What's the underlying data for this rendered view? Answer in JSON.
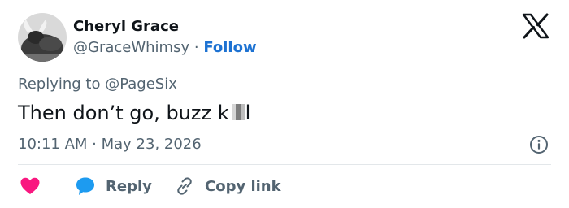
{
  "user": {
    "name": "Cheryl Grace",
    "handle": "@GraceWhimsy",
    "separator": "·",
    "follow_label": "Follow"
  },
  "tweet": {
    "replying_prefix": "Replying to",
    "replying_to": "@PageSix",
    "text_before": "Then don’t go, buzz k",
    "text_after": "l",
    "timestamp": "10:11 AM · May 23, 2026"
  },
  "actions": {
    "reply_label": "Reply",
    "copy_link_label": "Copy link"
  },
  "icons": {
    "logo": "x-logo-icon",
    "info": "info-icon",
    "like": "heart-icon",
    "reply": "speech-bubble-icon",
    "copy": "link-icon"
  },
  "colors": {
    "text": "#0f1419",
    "muted": "#536471",
    "link": "#1d72d2",
    "heart": "#f91880",
    "reply_bubble": "#1d9bf0",
    "divider": "#e3e7ea"
  }
}
